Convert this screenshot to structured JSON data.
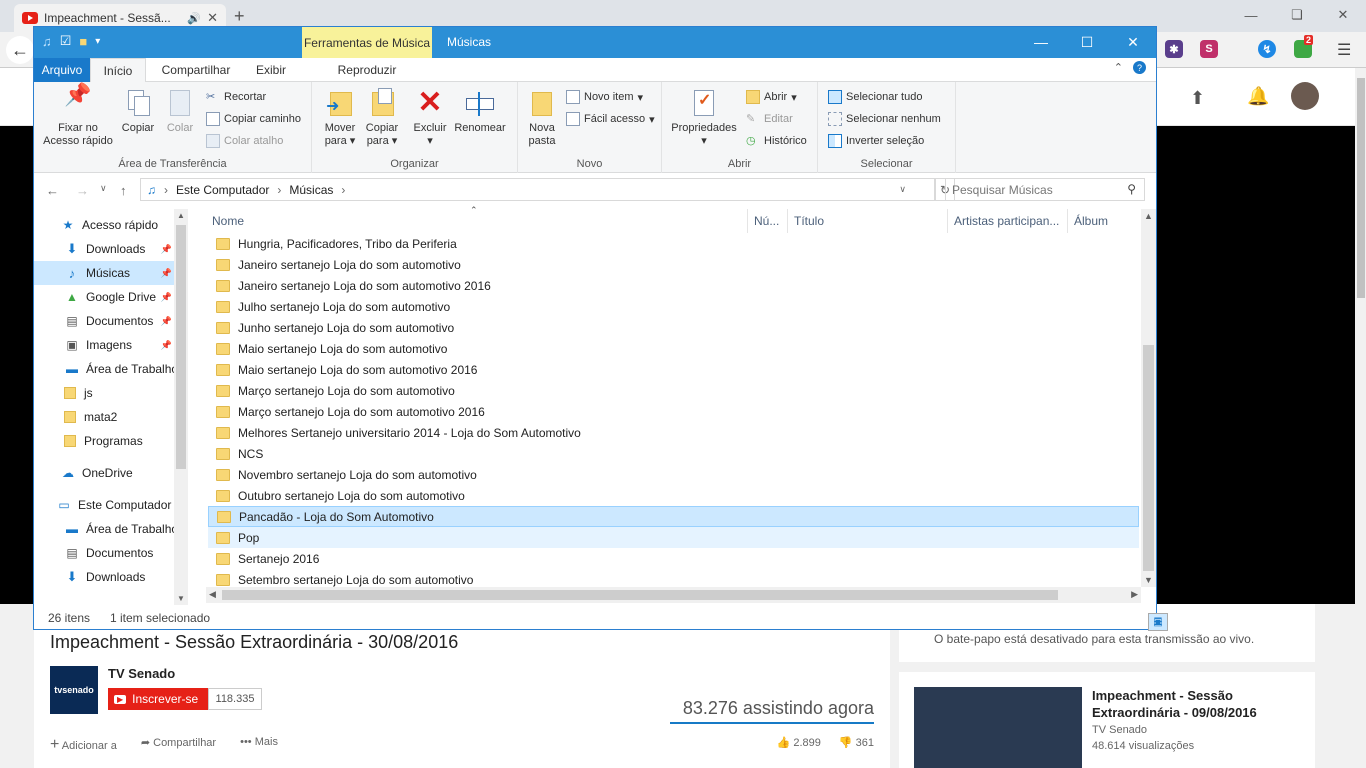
{
  "browser": {
    "tab_title": "Impeachment - Sessã...",
    "new_tab": "+",
    "ext_badge": "2"
  },
  "youtube": {
    "video_title": "Impeachment - Sessão Extraordinária - 30/08/2016",
    "channel_name": "TV Senado",
    "channel_logo": "tvsenado",
    "subscribe_label": "Inscrever-se",
    "subscriber_count": "118.335",
    "watching": "83.276 assistindo agora",
    "actions": [
      "Adicionar a",
      "Compartilhar",
      "Mais"
    ],
    "likes": "2.899",
    "dislikes": "361",
    "chat_disabled": "O bate-papo está desativado para esta transmissão ao vivo.",
    "rec": {
      "title": "Impeachment - Sessão Extraordinária - 09/08/2016",
      "channel": "TV Senado",
      "views": "48.614 visualizações"
    }
  },
  "explorer": {
    "context_tab": "Ferramentas de Música",
    "window_title": "Músicas",
    "ribbon_tabs": [
      "Arquivo",
      "Início",
      "Compartilhar",
      "Exibir",
      "Reproduzir"
    ],
    "clipboard": {
      "pin": "Fixar no Acesso rápido",
      "copy": "Copiar",
      "paste": "Colar",
      "cut": "Recortar",
      "copy_path": "Copiar caminho",
      "paste_shortcut": "Colar atalho",
      "label": "Área de Transferência"
    },
    "organize": {
      "move": "Mover para",
      "copy": "Copiar para",
      "delete": "Excluir",
      "rename": "Renomear",
      "label": "Organizar"
    },
    "new": {
      "folder": "Nova pasta",
      "item": "Novo item",
      "easy": "Fácil acesso",
      "label": "Novo"
    },
    "open": {
      "props": "Propriedades",
      "open": "Abrir",
      "edit": "Editar",
      "history": "Histórico",
      "label": "Abrir"
    },
    "select": {
      "all": "Selecionar tudo",
      "none": "Selecionar nenhum",
      "invert": "Inverter seleção",
      "label": "Selecionar"
    },
    "address": {
      "crumb1": "Este Computador",
      "crumb2": "Músicas",
      "search_placeholder": "Pesquisar Músicas"
    },
    "nav_items": [
      {
        "label": "Acesso rápido",
        "icon": "star-icon",
        "pin": false
      },
      {
        "label": "Downloads",
        "icon": "download-icon",
        "pin": true
      },
      {
        "label": "Músicas",
        "icon": "music-icon",
        "pin": true
      },
      {
        "label": "Google Drive",
        "icon": "drive-icon",
        "pin": true
      },
      {
        "label": "Documentos",
        "icon": "document-icon",
        "pin": true
      },
      {
        "label": "Imagens",
        "icon": "image-icon",
        "pin": true
      },
      {
        "label": "Área de Trabalho",
        "icon": "desktop-icon",
        "pin": false
      },
      {
        "label": "js",
        "icon": "folder-icon",
        "pin": false
      },
      {
        "label": "mata2",
        "icon": "folder-icon",
        "pin": false
      },
      {
        "label": "Programas",
        "icon": "folder-icon",
        "pin": false
      },
      {
        "label": "OneDrive",
        "icon": "cloud-icon",
        "pin": false
      },
      {
        "label": "Este Computador",
        "icon": "computer-icon",
        "pin": false
      },
      {
        "label": "Área de Trabalho",
        "icon": "desktop-icon",
        "pin": false
      },
      {
        "label": "Documentos",
        "icon": "document-icon",
        "pin": false
      },
      {
        "label": "Downloads",
        "icon": "download-icon",
        "pin": false
      }
    ],
    "columns": [
      "Nome",
      "Nú...",
      "Título",
      "Artistas participan...",
      "Álbum"
    ],
    "files": [
      "Hungria, Pacificadores, Tribo da Periferia",
      "Janeiro sertanejo Loja do som automotivo",
      "Janeiro sertanejo Loja do som automotivo 2016",
      "Julho sertanejo Loja do som automotivo",
      "Junho sertanejo Loja do som automotivo",
      "Maio sertanejo Loja do som automotivo",
      "Maio sertanejo Loja do som automotivo 2016",
      "Março sertanejo Loja do som automotivo",
      "Março sertanejo Loja do som automotivo 2016",
      "Melhores Sertanejo universitario 2014 - Loja do Som Automotivo",
      "NCS",
      "Novembro sertanejo Loja do som automotivo",
      "Outubro sertanejo Loja do som automotivo",
      "Pancadão - Loja do Som Automotivo",
      "Pop",
      "Sertanejo 2016",
      "Setembro sertanejo Loja do som automotivo"
    ],
    "selected_file": "Pancadão - Loja do Som Automotivo",
    "status": {
      "count": "26 itens",
      "selection": "1 item selecionado"
    }
  }
}
